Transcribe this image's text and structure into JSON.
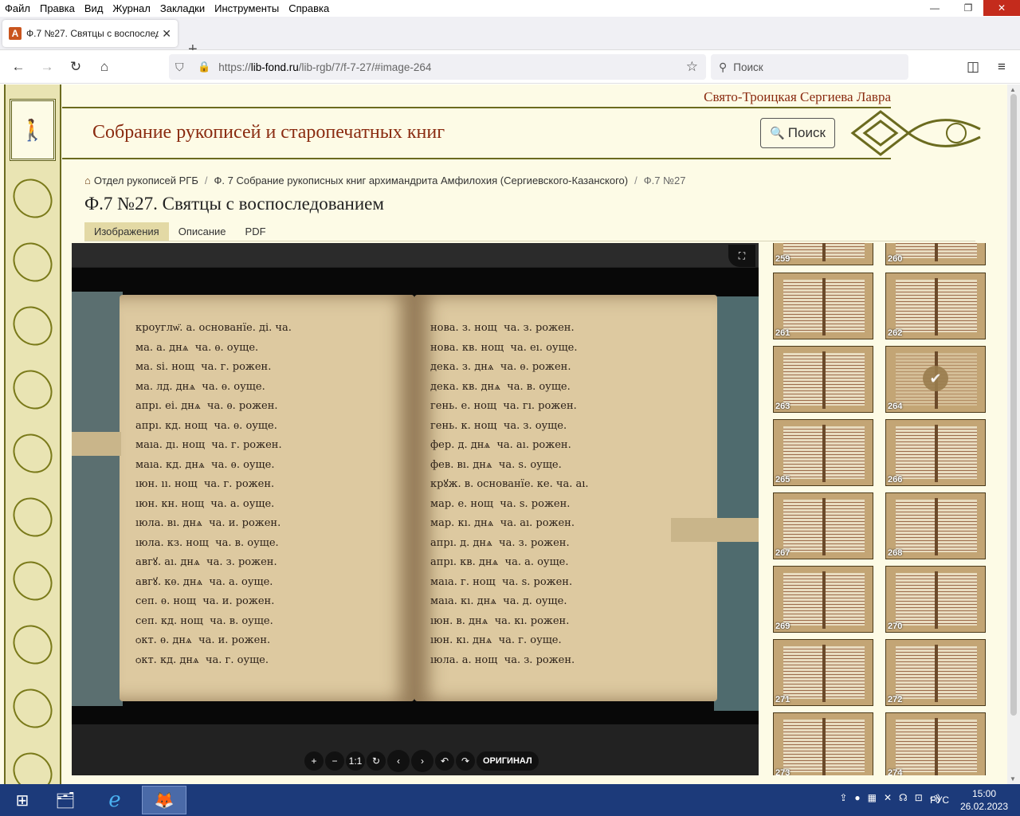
{
  "menu": [
    "Файл",
    "Правка",
    "Вид",
    "Журнал",
    "Закладки",
    "Инструменты",
    "Справка"
  ],
  "window_controls": {
    "minimize": "—",
    "restore": "❐",
    "close": "✕"
  },
  "tab": {
    "favicon": "А",
    "title": "Ф.7 №27. Святцы с воспослед",
    "close": "✕",
    "new_tab": "+"
  },
  "nav": {
    "back": "←",
    "forward": "→",
    "reload": "↻",
    "home": "⌂",
    "shield": "⛉",
    "lock": "🔒",
    "url_prefix": "https://",
    "url_domain": "lib-fond.ru",
    "url_path": "/lib-rgb/7/f-7-27/#image-264",
    "star": "☆",
    "search_placeholder": "Поиск",
    "search_icon": "⚲",
    "pocket": "◫",
    "menu": "≡"
  },
  "site": {
    "monastery": "Свято-Троицкая Сергиева Лавра",
    "title": "Собрание рукописей и старопечатных книг",
    "search_button": "Поиск",
    "logo": "🚶"
  },
  "breadcrumbs": {
    "home_icon": "⌂",
    "items": [
      "Отдел рукописей РГБ",
      "Ф. 7 Собрание рукописных книг архимандрита Амфилохия (Сергиевского-Казанского)",
      "Ф.7 №27"
    ]
  },
  "page_title": "Ф.7 №27. Святцы с воспоследованием",
  "page_tabs": [
    "Изображения",
    "Описание",
    "PDF"
  ],
  "active_tab": "Изображения",
  "viewer": {
    "fullscreen_icon": "⛶",
    "controls": [
      "+",
      "−",
      "1:1",
      "↻",
      "‹",
      "›",
      "↶",
      "↷",
      "ОРИГИНАЛ"
    ],
    "page_left": "кроуглѡ̈. а. основанїе. ді. ча.\nма. а. днѧ  ча. ѳ. оуще.\nма. ѕі. нощ  ча. г. рожен.\nма. лд. днѧ  ча. ѳ. оуще.\nапрı. еі. днѧ  ча. ѳ. рожен.\nапрı. кд. нощ  ча. ѳ. оуще.\nмаıа. дı. нощ  ча. г. рожен.\nмаıа. кд. днѧ  ча. ѳ. оуще.\nıюн. ıı. нощ  ча. г. рожен.\nıюн. кн. нощ  ча. а. оуще.\nıюла. вı. днѧ  ча. и. рожен.\nıюла. кз. нощ  ча. в. оуще.\nавгꙋ. аı. днѧ  ча. з. рожен.\nавгꙋ. кѳ. днѧ  ча. а. оуще.\nсеп. ѳ. нощ  ча. и. рожен.\nсеп. кд. нощ  ча. в. оуще.\nѻкт. ѳ. днѧ  ча. и. рожен.\nѻкт. кд. днѧ  ча. г. оуще.",
    "page_right": "нова. з. нощ  ча. з. рожен.\nнова. кв. нощ  ча. еı. оуще.\nдека. з. днѧ  ча. ѳ. рожен.\nдека. кв. днѧ  ча. в. оуще.\nгень. е. нощ  ча. гı. рожен.\nгень. к. нощ  ча. з. оуще.\nфер. д. днѧ  ча. аı. рожен.\nфев. вı. днѧ  ча. ѕ. оуще.\nкрꙋж. в. основанїе. ке. ча. аı.\nмар. е. нощ  ча. ѕ. рожен.\nмар. кı. днѧ  ча. аı. рожен.\nапрı. д. днѧ  ча. з. рожен.\nапрı. кв. днѧ  ча. а. оуще.\nмаıа. г. нощ  ча. ѕ. рожен.\nмаıа. кı. днѧ  ча. д. оуще.\nıюн. в. днѧ  ча. кı. рожен.\nıюн. кı. днѧ  ча. г. оуще.\nıюла. а. нощ  ча. з. рожен."
  },
  "thumbnails": [
    {
      "num": "259"
    },
    {
      "num": "260"
    },
    {
      "num": "261"
    },
    {
      "num": "262"
    },
    {
      "num": "263"
    },
    {
      "num": "264",
      "selected": true
    },
    {
      "num": "265"
    },
    {
      "num": "266"
    },
    {
      "num": "267"
    },
    {
      "num": "268"
    },
    {
      "num": "269"
    },
    {
      "num": "270"
    },
    {
      "num": "271"
    },
    {
      "num": "272"
    },
    {
      "num": "273"
    },
    {
      "num": "274"
    }
  ],
  "taskbar": {
    "start": "⊞",
    "explorer": "🗂",
    "ie": "e",
    "firefox": "🦊",
    "lang": "РУС",
    "time": "15:00",
    "date": "26.02.2023",
    "tray": [
      "⇪",
      "●",
      "▦",
      "✕",
      "☊",
      "⊡",
      "◁)"
    ]
  },
  "colors": {
    "accent": "#8a2b10",
    "page_bg": "#fdfbe6",
    "tab_active": "#e3d9a5",
    "taskbar": "#1c3a7a"
  }
}
